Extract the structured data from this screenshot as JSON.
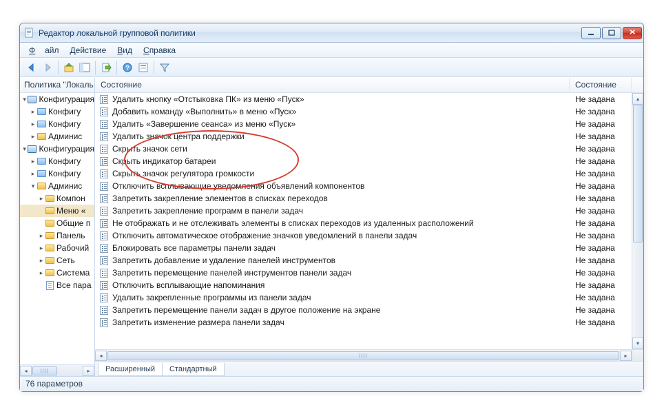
{
  "window": {
    "title": "Редактор локальной групповой политики"
  },
  "menu": {
    "file": "Файл",
    "action": "Действие",
    "view": "Вид",
    "help": "Справка"
  },
  "tree": {
    "header": "Политика \"Локаль",
    "nodes": [
      {
        "level": 1,
        "exp": "▾",
        "icon": "pc",
        "label": "Конфигурация"
      },
      {
        "level": 2,
        "exp": "▸",
        "icon": "folder-blue",
        "label": "Конфигу"
      },
      {
        "level": 2,
        "exp": "▸",
        "icon": "folder-blue",
        "label": "Конфигу"
      },
      {
        "level": 2,
        "exp": "▸",
        "icon": "folder",
        "label": "Админис"
      },
      {
        "level": 1,
        "exp": "▾",
        "icon": "pc",
        "label": "Конфигурация"
      },
      {
        "level": 2,
        "exp": "▸",
        "icon": "folder-blue",
        "label": "Конфигу"
      },
      {
        "level": 2,
        "exp": "▸",
        "icon": "folder-blue",
        "label": "Конфигу"
      },
      {
        "level": 2,
        "exp": "▾",
        "icon": "folder",
        "label": "Админис"
      },
      {
        "level": 3,
        "exp": "▸",
        "icon": "folder",
        "label": "Компон"
      },
      {
        "level": 3,
        "exp": "",
        "icon": "folder",
        "label": "Меню «",
        "sel": true
      },
      {
        "level": 3,
        "exp": "",
        "icon": "folder",
        "label": "Общие п"
      },
      {
        "level": 3,
        "exp": "▸",
        "icon": "folder",
        "label": "Панель"
      },
      {
        "level": 3,
        "exp": "▸",
        "icon": "folder",
        "label": "Рабочий"
      },
      {
        "level": 3,
        "exp": "▸",
        "icon": "folder",
        "label": "Сеть"
      },
      {
        "level": 3,
        "exp": "▸",
        "icon": "folder",
        "label": "Система"
      },
      {
        "level": 3,
        "exp": "",
        "icon": "doc",
        "label": "Все пара"
      }
    ]
  },
  "list": {
    "col1": "Состояние",
    "col2": "Состояние",
    "state": "Не задана",
    "rows": [
      "Удалить кнопку «Отстыковка ПК» из меню «Пуск»",
      "Добавить команду «Выполнить» в меню «Пуск»",
      "Удалить «Завершение сеанса» из меню «Пуск»",
      "Удалить значок центра поддержки",
      "Скрыть значок сети",
      "Скрыть индикатор батареи",
      "Скрыть значок регулятора громкости",
      "Отключить всплывающие уведомления объявлений компонентов",
      "Запретить закрепление элементов в списках переходов",
      "Запретить закрепление программ в панели задач",
      "Не отображать и не отслеживать элементы в списках переходов из удаленных расположений",
      "Отключить автоматическое отображение значков уведомлений в панели задач",
      "Блокировать все параметры панели задач",
      "Запретить добавление и удаление панелей инструментов",
      "Запретить перемещение панелей инструментов панели задач",
      "Отключить всплывающие напоминания",
      "Удалить закрепленные программы из панели задач",
      "Запретить перемещение панели задач в другое положение на экране",
      "Запретить изменение размера панели задач"
    ]
  },
  "tabs": {
    "extended": "Расширенный",
    "standard": "Стандартный"
  },
  "statusbar": "76 параметров"
}
